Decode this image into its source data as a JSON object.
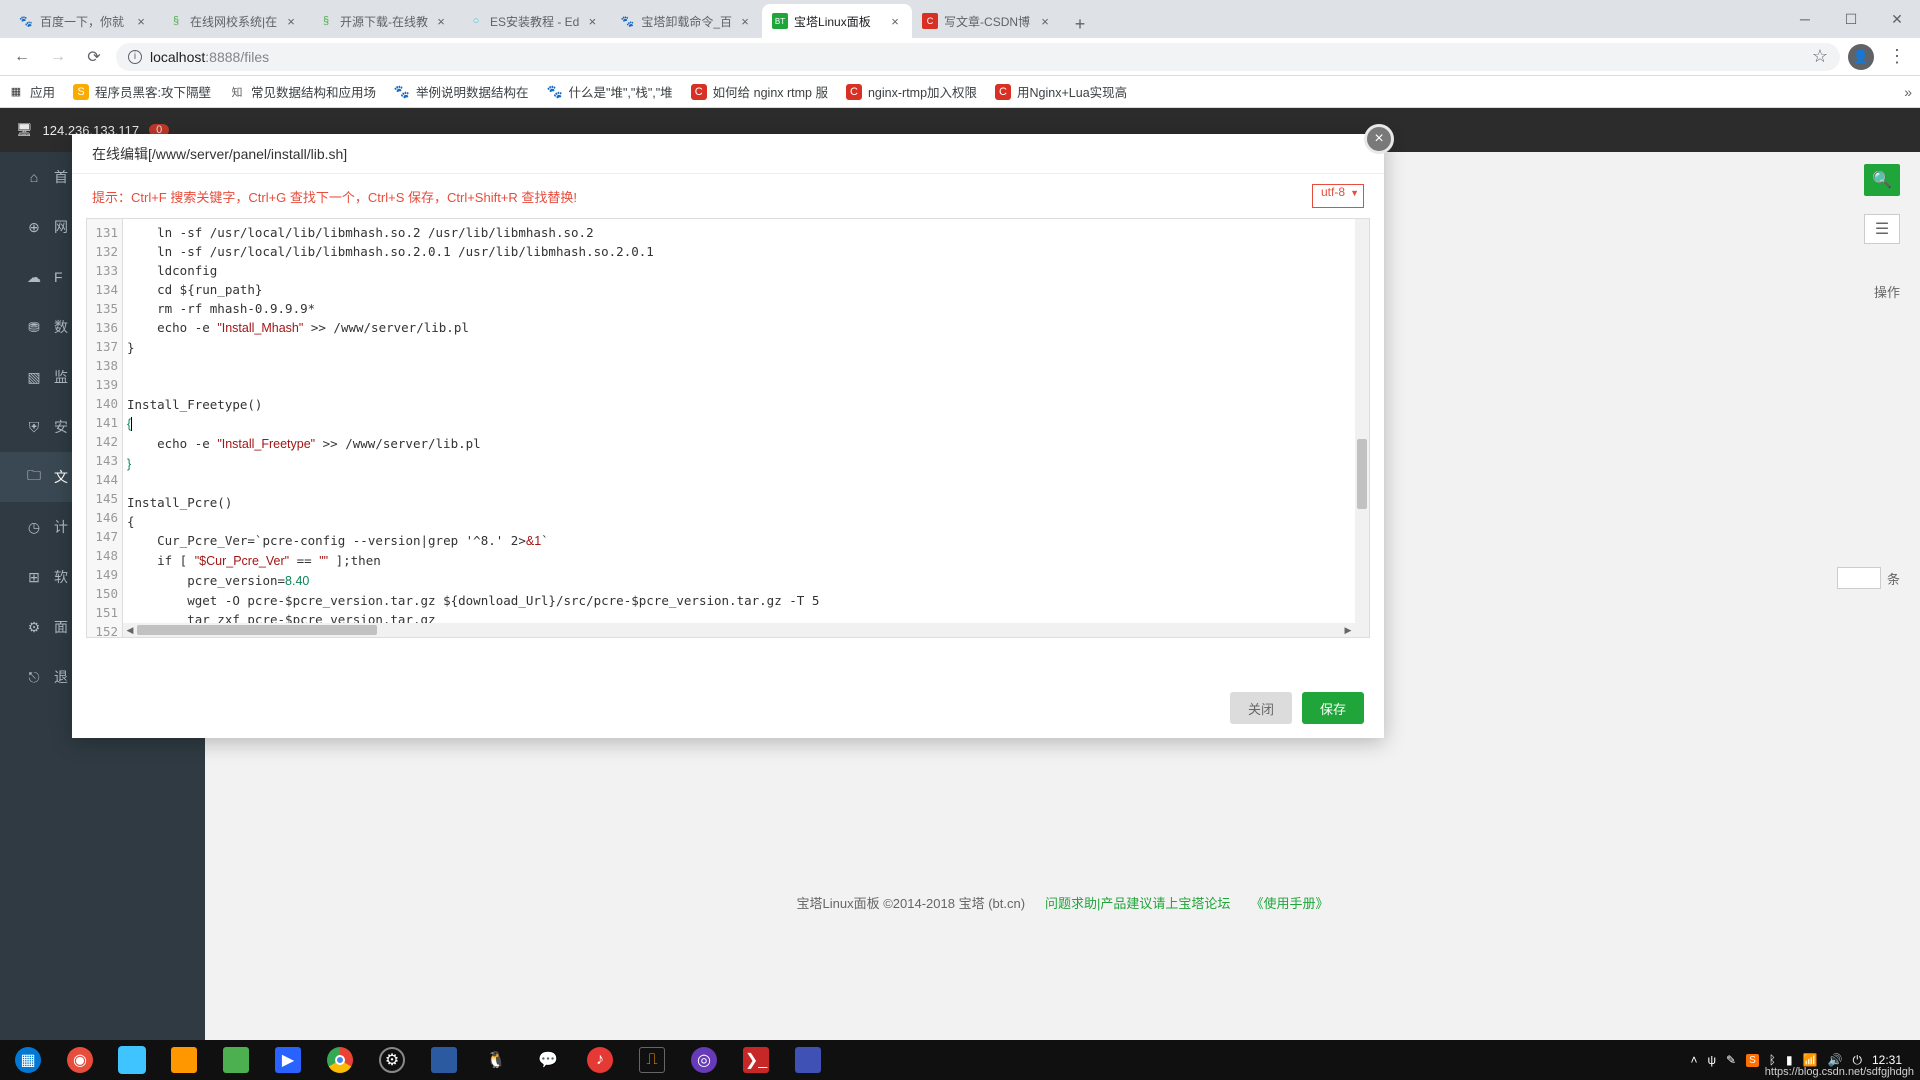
{
  "browser": {
    "tabs": [
      {
        "title": "百度一下，你就",
        "favicon": "🐾"
      },
      {
        "title": "在线网校系统|在",
        "favicon": "§"
      },
      {
        "title": "开源下载-在线教",
        "favicon": "§"
      },
      {
        "title": "ES安装教程 - Ed",
        "favicon": "○"
      },
      {
        "title": "宝塔卸载命令_百",
        "favicon": "🐾"
      },
      {
        "title": "宝塔Linux面板",
        "favicon": "BT",
        "active": true
      },
      {
        "title": "写文章-CSDN博",
        "favicon": "C"
      }
    ],
    "url_host": "localhost",
    "url_port": ":8888",
    "url_path": "/files"
  },
  "bookmarks": {
    "apps": "应用",
    "items": [
      "程序员黑客:攻下隔壁",
      "常见数据结构和应用场",
      "举例说明数据结构在",
      "什么是\"堆\",\"栈\",\"堆",
      "如何给 nginx rtmp 服",
      "nginx-rtmp加入权限",
      "用Nginx+Lua实现高"
    ]
  },
  "panel": {
    "ip": "124.236.133.117",
    "badge": "0",
    "sidebar": [
      "首",
      "网",
      "F",
      "数",
      "监",
      "安",
      "文",
      "计",
      "软",
      "面",
      "退"
    ],
    "op_header": "操作",
    "count_label": "条",
    "footer_copyright": "宝塔Linux面板 ©2014-2018 宝塔 (bt.cn)",
    "footer_link1": "问题求助|产品建议请上宝塔论坛",
    "footer_link2": "《使用手册》"
  },
  "modal": {
    "title": "在线编辑[/www/server/panel/install/lib.sh]",
    "tip": "提示：Ctrl+F 搜索关键字，Ctrl+G 查找下一个，Ctrl+S 保存，Ctrl+Shift+R 查找替换!",
    "encoding": "utf-8",
    "close_btn": "关闭",
    "save_btn": "保存",
    "line_start": 131,
    "line_end": 152,
    "code": {
      "l131": "    ln -sf /usr/local/lib/libmhash.so.2 /usr/lib/libmhash.so.2",
      "l132": "    ln -sf /usr/local/lib/libmhash.so.2.0.1 /usr/lib/libmhash.so.2.0.1",
      "l133": "    ldconfig",
      "l134": "    cd ${run_path}",
      "l135": "    rm -rf mhash-0.9.9.9*",
      "l136_a": "    echo -e ",
      "l136_s": "\"Install_Mhash\"",
      "l136_b": " >> /www/server/lib.pl",
      "l137": "}",
      "l140": "Install_Freetype()",
      "l141": "{",
      "l142_a": "    echo -e ",
      "l142_s": "\"Install_Freetype\"",
      "l142_b": " >> /www/server/lib.pl",
      "l143": "}",
      "l145": "Install_Pcre()",
      "l146": "{",
      "l147_a": "    Cur_Pcre_Ver=`pcre-config --version|grep '^8.' 2>",
      "l147_b": "&1",
      "l147_c": "`",
      "l148_a": "    if [ ",
      "l148_s": "\"$Cur_Pcre_Ver\"",
      "l148_b": " == ",
      "l148_s2": "\"\"",
      "l148_c": " ];then",
      "l149_a": "        pcre_version=",
      "l149_n": "8.40",
      "l150": "        wget -O pcre-$pcre_version.tar.gz ${download_Url}/src/pcre-$pcre_version.tar.gz -T 5",
      "l151": "        tar zxf pcre-$pcre_version.tar.gz"
    }
  },
  "taskbar": {
    "time": "12:31",
    "watermark": "https://blog.csdn.net/sdfgjhdgh"
  }
}
